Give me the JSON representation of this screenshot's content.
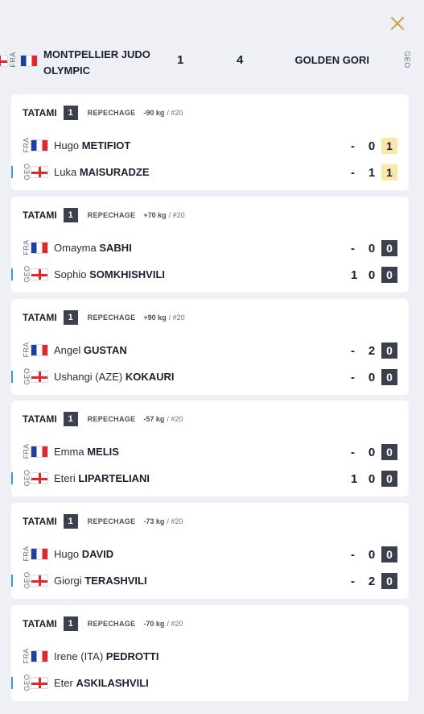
{
  "header": {
    "home_code": "FRA",
    "home_name": "MONTPELLIER JUDO OLYMPIC",
    "home_score": "1",
    "away_score": "4",
    "away_name": "GOLDEN GORI",
    "away_code": "GEO"
  },
  "colors": {
    "accent": "#c9a040",
    "dark_badge": "#3b3f4e",
    "shido_badge": "#fbe7a8",
    "winner_marker": "#3b9bd6"
  },
  "matches": [
    {
      "tatami_label": "TATAMI",
      "tatami_num": "1",
      "phase": "REPECHAGE",
      "weight": "-90 kg",
      "pool": "/ #20",
      "home": {
        "code": "FRA",
        "first": "Hugo",
        "last": "METIFIOT",
        "dash": "-",
        "s1": "0",
        "s2": "1",
        "s2_style": "yellow",
        "winner": false
      },
      "away": {
        "code": "GEO",
        "first": "Luka",
        "last": "MAISURADZE",
        "dash": "-",
        "s1": "1",
        "s2": "1",
        "s2_style": "yellow",
        "winner": true
      }
    },
    {
      "tatami_label": "TATAMI",
      "tatami_num": "1",
      "phase": "REPECHAGE",
      "weight": "+70 kg",
      "pool": "/ #20",
      "home": {
        "code": "FRA",
        "first": "Omayma",
        "last": "SABHI",
        "dash": "-",
        "s1": "0",
        "s2": "0",
        "s2_style": "dark",
        "winner": false
      },
      "away": {
        "code": "GEO",
        "first": "Sophio",
        "last": "SOMKHISHVILI",
        "dash": "1",
        "s1": "0",
        "s2": "0",
        "s2_style": "dark",
        "winner": true
      }
    },
    {
      "tatami_label": "TATAMI",
      "tatami_num": "1",
      "phase": "REPECHAGE",
      "weight": "+90 kg",
      "pool": "/ #20",
      "home": {
        "code": "FRA",
        "first": "Angel",
        "last": "GUSTAN",
        "dash": "-",
        "s1": "2",
        "s2": "0",
        "s2_style": "dark",
        "winner": false
      },
      "away": {
        "code": "GEO",
        "first": "Ushangi (AZE)",
        "last": "KOKAURI",
        "dash": "-",
        "s1": "0",
        "s2": "0",
        "s2_style": "dark",
        "winner": true
      }
    },
    {
      "tatami_label": "TATAMI",
      "tatami_num": "1",
      "phase": "REPECHAGE",
      "weight": "-57 kg",
      "pool": "/ #20",
      "home": {
        "code": "FRA",
        "first": "Emma",
        "last": "MELIS",
        "dash": "-",
        "s1": "0",
        "s2": "0",
        "s2_style": "dark",
        "winner": false
      },
      "away": {
        "code": "GEO",
        "first": "Eteri",
        "last": "LIPARTELIANI",
        "dash": "1",
        "s1": "0",
        "s2": "0",
        "s2_style": "dark",
        "winner": true
      }
    },
    {
      "tatami_label": "TATAMI",
      "tatami_num": "1",
      "phase": "REPECHAGE",
      "weight": "-73 kg",
      "pool": "/ #20",
      "home": {
        "code": "FRA",
        "first": "Hugo",
        "last": "DAVID",
        "dash": "-",
        "s1": "0",
        "s2": "0",
        "s2_style": "dark",
        "winner": false
      },
      "away": {
        "code": "GEO",
        "first": "Giorgi",
        "last": "TERASHVILI",
        "dash": "-",
        "s1": "2",
        "s2": "0",
        "s2_style": "dark",
        "winner": true
      }
    },
    {
      "tatami_label": "TATAMI",
      "tatami_num": "1",
      "phase": "REPECHAGE",
      "weight": "-70 kg",
      "pool": "/ #20",
      "home": {
        "code": "FRA",
        "first": "Irene (ITA)",
        "last": "PEDROTTI",
        "dash": "",
        "s1": "",
        "s2": "",
        "s2_style": "none",
        "winner": false
      },
      "away": {
        "code": "GEO",
        "first": "Eter",
        "last": "ASKILASHVILI",
        "dash": "",
        "s1": "",
        "s2": "",
        "s2_style": "none",
        "winner": true
      }
    }
  ]
}
